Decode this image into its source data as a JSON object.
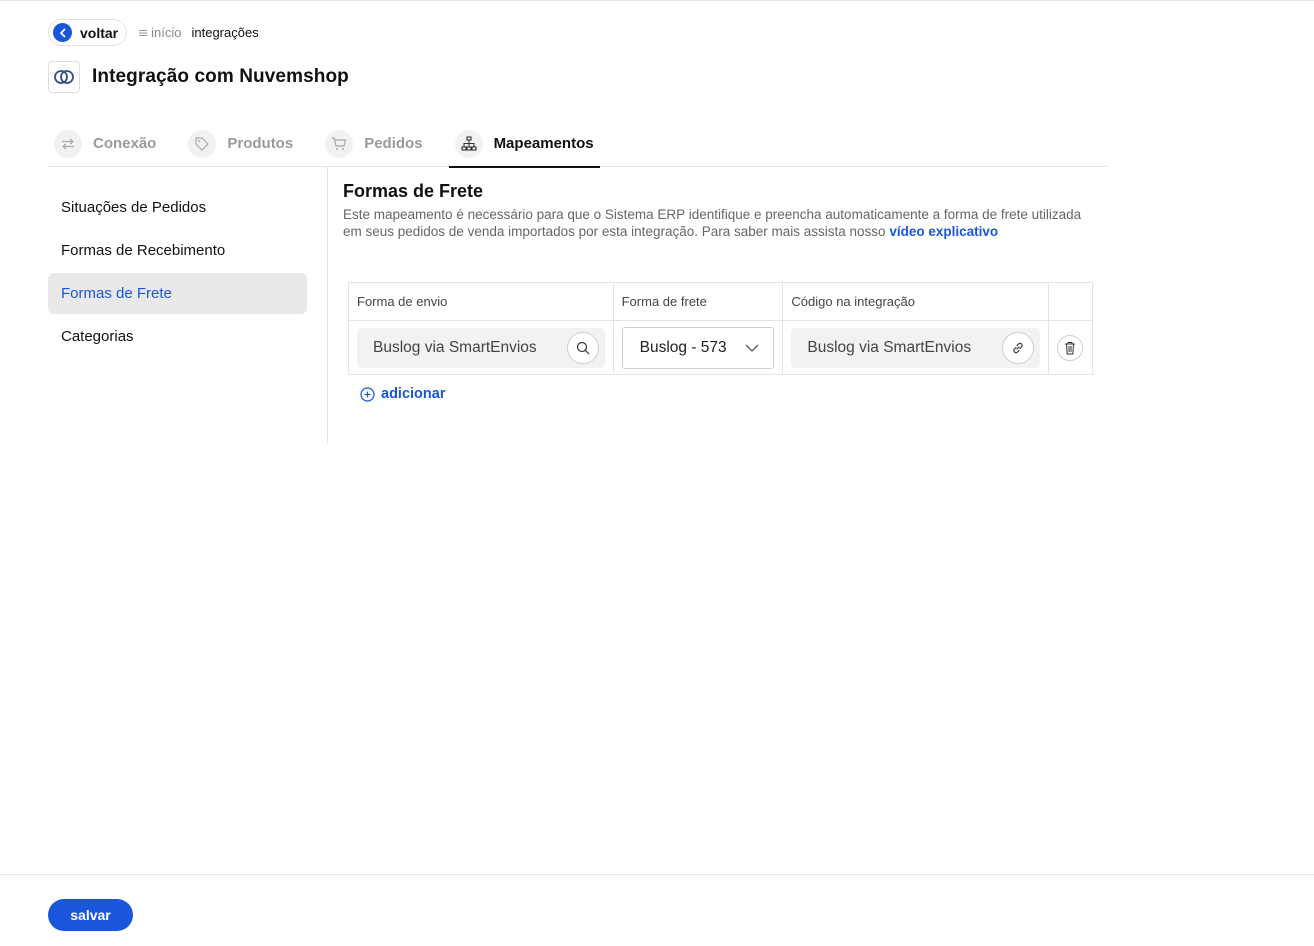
{
  "breadcrumb": {
    "back_label": "voltar",
    "home_label": "início",
    "current_label": "integrações"
  },
  "header": {
    "title": "Integração com Nuvemshop"
  },
  "tabs": [
    {
      "label": "Conexão",
      "icon": "arrows-exchange-icon",
      "active": false
    },
    {
      "label": "Produtos",
      "icon": "tag-icon",
      "active": false
    },
    {
      "label": "Pedidos",
      "icon": "cart-icon",
      "active": false
    },
    {
      "label": "Mapeamentos",
      "icon": "sitemap-icon",
      "active": true
    }
  ],
  "sidebar": {
    "items": [
      {
        "label": "Situações de Pedidos",
        "active": false
      },
      {
        "label": "Formas de Recebimento",
        "active": false
      },
      {
        "label": "Formas de Frete",
        "active": true
      },
      {
        "label": "Categorias",
        "active": false
      }
    ]
  },
  "section": {
    "title": "Formas de Frete",
    "description": "Este mapeamento é necessário para que o Sistema ERP identifique e preencha automaticamente a forma de frete utilizada em seus pedidos de venda importados por esta integração. Para saber mais assista nosso ",
    "link_label": "vídeo explicativo"
  },
  "table": {
    "headers": [
      "Forma de envio",
      "Forma de frete",
      "Código na integração",
      ""
    ],
    "rows": [
      {
        "forma_envio": "Buslog via SmartEnvios",
        "forma_frete": "Buslog - 573",
        "codigo": "Buslog via SmartEnvios"
      }
    ]
  },
  "add_label": "adicionar",
  "footer": {
    "save_label": "salvar"
  },
  "colors": {
    "accent": "#1a56db",
    "active_bg": "#e9e9e9",
    "input_bg": "#f2f2f2"
  }
}
